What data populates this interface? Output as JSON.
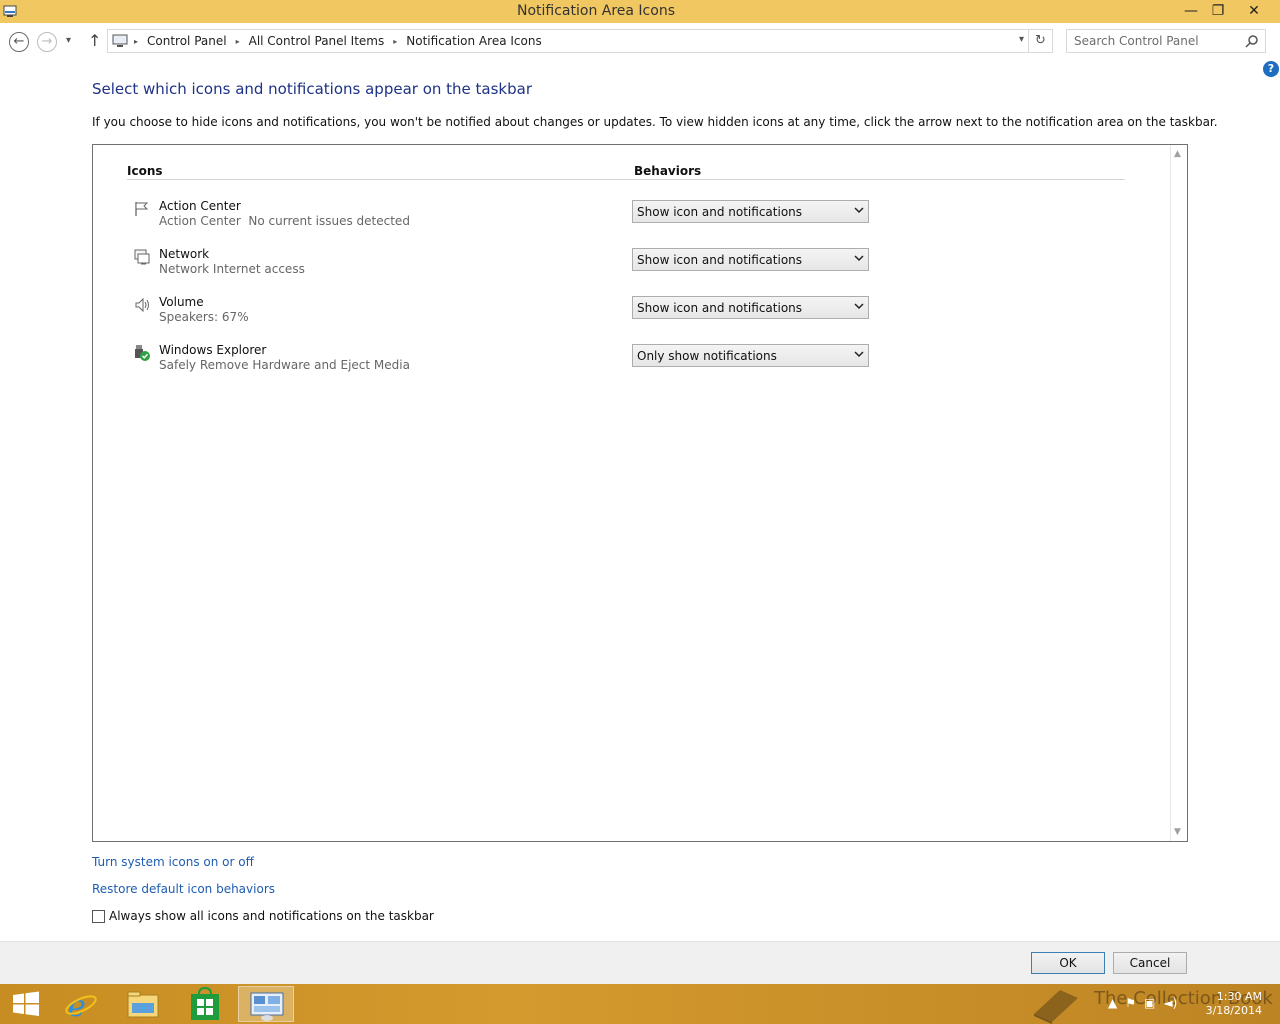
{
  "window": {
    "title": "Notification Area Icons",
    "minimize": "—",
    "restore": "❐",
    "close": "✕"
  },
  "nav": {
    "back_icon": "←",
    "forward_icon": "→",
    "recent_icon": "▾",
    "up_icon": "↑",
    "refresh_icon": "↻",
    "breadcrumbs": [
      "Control Panel",
      "All Control Panel Items",
      "Notification Area Icons"
    ],
    "crumb_sep": "▸",
    "search_placeholder": "Search Control Panel"
  },
  "help_label": "?",
  "heading": "Select which icons and notifications appear on the taskbar",
  "description": "If you choose to hide icons and notifications, you won't be notified about changes or updates. To view hidden icons at any time, click the arrow next to the notification area on the taskbar.",
  "table": {
    "col_icons": "Icons",
    "col_behaviors": "Behaviors",
    "rows": [
      {
        "icon": "flag-icon",
        "name": "Action Center",
        "sub": "Action Center  No current issues detected",
        "behavior": "Show icon and notifications"
      },
      {
        "icon": "network-icon",
        "name": "Network",
        "sub": "Network Internet access",
        "behavior": "Show icon and notifications"
      },
      {
        "icon": "speaker-icon",
        "name": "Volume",
        "sub": "Speakers: 67%",
        "behavior": "Show icon and notifications"
      },
      {
        "icon": "usb-eject-icon",
        "name": "Windows Explorer",
        "sub": "Safely Remove Hardware and Eject Media",
        "behavior": "Only show notifications"
      }
    ]
  },
  "scroll_up": "▲",
  "scroll_down": "▼",
  "links": {
    "system_icons": "Turn system icons on or off",
    "restore": "Restore default icon behaviors"
  },
  "always_show": {
    "label": "Always show all icons and notifications on the taskbar",
    "checked": false
  },
  "buttons": {
    "ok": "OK",
    "cancel": "Cancel"
  },
  "taskbar": {
    "items": [
      "start-icon",
      "internet-explorer-icon",
      "file-explorer-icon",
      "store-icon",
      "control-panel-icon"
    ],
    "tray_time": "1:30 AM",
    "tray_date": "3/18/2014",
    "watermark": "The Collection Book"
  },
  "colors": {
    "titlebar": "#f1c761",
    "taskbar": "#c78d22",
    "heading": "#1e3287",
    "link": "#1e5cb3"
  }
}
